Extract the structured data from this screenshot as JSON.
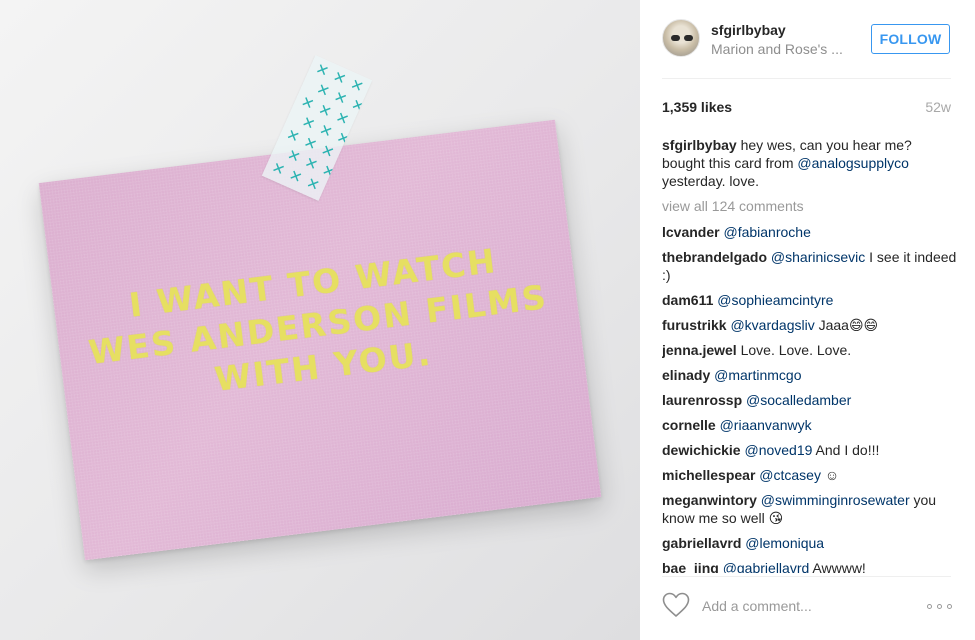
{
  "post": {
    "image": {
      "card_lines": [
        "I WANT TO WATCH",
        "WES ANDERSON FILMS",
        "WITH YOU."
      ]
    },
    "author": {
      "username": "sfgirlbybay",
      "location": "Marion and Rose's ..."
    },
    "follow_label": "FOLLOW",
    "likes": "1,359 likes",
    "age": "52w",
    "caption": {
      "username": "sfgirlbybay",
      "text_1": " hey wes, can you hear me? bought this card from ",
      "mention": "@analogsupplyco",
      "text_2": " yesterday. love."
    },
    "view_all_comments": "view all 124 comments",
    "comments": [
      {
        "user": "lcvander",
        "mention": "@fabianroche",
        "text": ""
      },
      {
        "user": "thebrandelgado",
        "mention": "@sharinicsevic",
        "text": " I see it indeed :)"
      },
      {
        "user": "dam611",
        "mention": "@sophieamcintyre",
        "text": ""
      },
      {
        "user": "furustrikk",
        "mention": "@kvardagsliv",
        "text": " Jaaa😄😄"
      },
      {
        "user": "jenna.jewel",
        "mention": "",
        "text": " Love. Love. Love."
      },
      {
        "user": "elinady",
        "mention": "@martinmcgo",
        "text": ""
      },
      {
        "user": "laurenrossp",
        "mention": "@socalledamber",
        "text": ""
      },
      {
        "user": "cornelle",
        "mention": "@riaanvanwyk",
        "text": ""
      },
      {
        "user": "dewichickie",
        "mention": "@noved19",
        "text": " And I do!!!"
      },
      {
        "user": "michellespear",
        "mention": "@ctcasey",
        "text": " ☺"
      },
      {
        "user": "meganwintory",
        "mention": "@swimminginrosewater",
        "text": " you know me so well 😘"
      },
      {
        "user": "gabriellavrd",
        "mention": "@lemoniqua",
        "text": ""
      },
      {
        "user": "bae_jing",
        "mention": "@gabriellavrd",
        "text": " Awwww!"
      }
    ],
    "add_comment_placeholder": "Add a comment...",
    "icons": {
      "like": "heart-outline-icon",
      "more": "more-options-icon"
    }
  }
}
